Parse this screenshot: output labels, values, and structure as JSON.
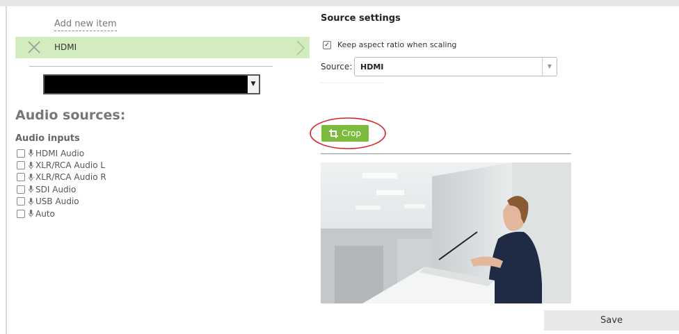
{
  "left": {
    "add_new_label": "Add new item",
    "selected_item": {
      "label": "HDMI"
    },
    "audio_heading": "Audio sources:",
    "inputs_heading": "Audio inputs",
    "audio_inputs": [
      {
        "label": "HDMI Audio",
        "checked": false
      },
      {
        "label": "XLR/RCA Audio L",
        "checked": false
      },
      {
        "label": "XLR/RCA Audio R",
        "checked": false
      },
      {
        "label": "SDI Audio",
        "checked": false
      },
      {
        "label": "USB Audio",
        "checked": false
      },
      {
        "label": "Auto",
        "checked": false
      }
    ]
  },
  "right": {
    "heading": "Source settings",
    "keep_aspect_label": "Keep aspect ratio when scaling",
    "keep_aspect_checked": true,
    "source_label": "Source:",
    "source_value": "HDMI",
    "crop_label": "Crop",
    "save_label": "Save"
  },
  "colors": {
    "item_highlight": "#d2ecc0",
    "crop_green": "#7dbb3f",
    "annotation_red": "#d9202a"
  },
  "icons": {
    "remove": "close-icon",
    "expand": "chevron-right-icon",
    "mic": "microphone-icon",
    "crop": "crop-icon"
  }
}
